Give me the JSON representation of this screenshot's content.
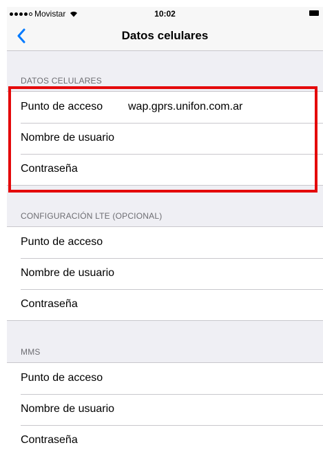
{
  "status": {
    "carrier": "Movistar",
    "time": "10:02"
  },
  "nav": {
    "title": "Datos celulares"
  },
  "sections": [
    {
      "header": "DATOS CELULARES",
      "rows": [
        {
          "label": "Punto de acceso",
          "value": "wap.gprs.unifon.com.ar"
        },
        {
          "label": "Nombre de usuario",
          "value": ""
        },
        {
          "label": "Contraseña",
          "value": ""
        }
      ]
    },
    {
      "header": "CONFIGURACIÓN LTE (OPCIONAL)",
      "rows": [
        {
          "label": "Punto de acceso",
          "value": ""
        },
        {
          "label": "Nombre de usuario",
          "value": ""
        },
        {
          "label": "Contraseña",
          "value": ""
        }
      ]
    },
    {
      "header": "MMS",
      "rows": [
        {
          "label": "Punto de acceso",
          "value": ""
        },
        {
          "label": "Nombre de usuario",
          "value": ""
        },
        {
          "label": "Contraseña",
          "value": ""
        }
      ]
    }
  ],
  "colors": {
    "accent": "#007aff",
    "highlight": "#e4080a"
  }
}
